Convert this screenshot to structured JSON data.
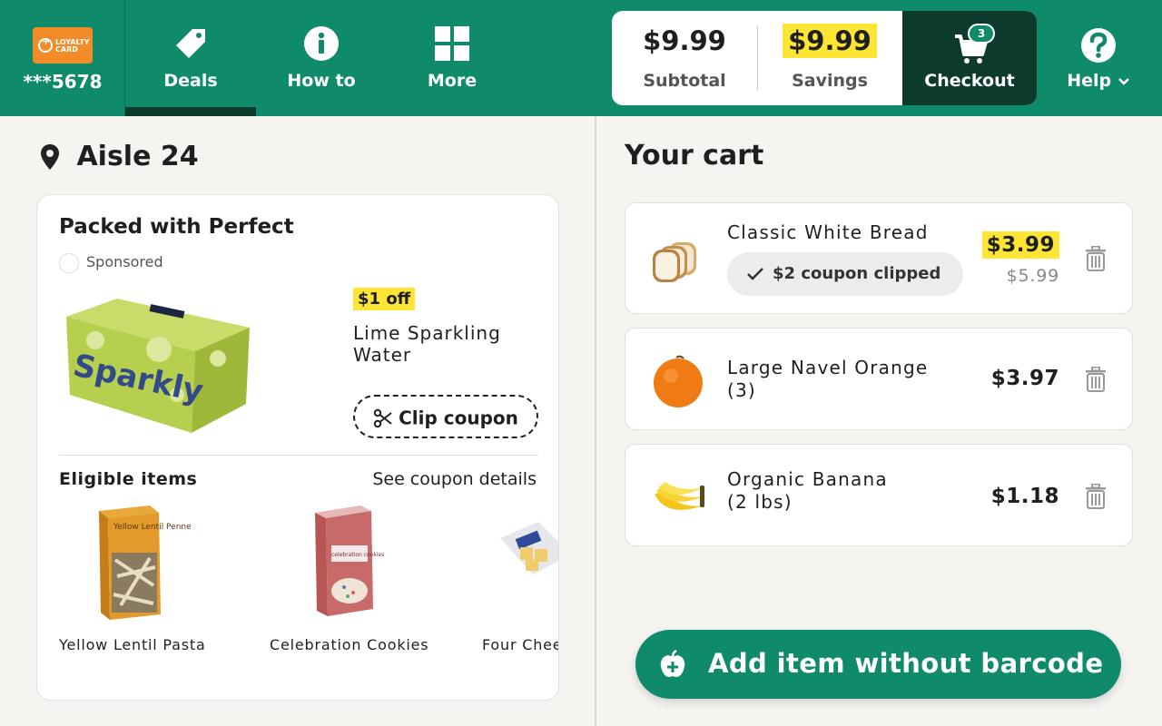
{
  "header": {
    "loyalty": {
      "card_label": "LOYALTY CARD",
      "number": "***5678"
    },
    "nav": [
      {
        "label": "Deals",
        "icon": "tag-icon",
        "active": true
      },
      {
        "label": "How to",
        "icon": "info-icon",
        "active": false
      },
      {
        "label": "More",
        "icon": "grid-icon",
        "active": false
      }
    ],
    "totals": {
      "subtotal_amount": "$9.99",
      "subtotal_label": "Subtotal",
      "savings_amount": "$9.99",
      "savings_label": "Savings"
    },
    "checkout": {
      "label": "Checkout",
      "count": "3"
    },
    "help": {
      "label": "Help"
    }
  },
  "left": {
    "location": "Aisle 24",
    "deal": {
      "title": "Packed with Perfect",
      "sponsored": "Sponsored",
      "product_box_text": "Sparkly",
      "badge": "$1 off",
      "product_name": "Lime Sparkling Water",
      "clip_label": "Clip coupon",
      "eligible_label": "Eligible items",
      "details_link": "See coupon details",
      "items": [
        {
          "name": "Yellow Lentil Pasta",
          "box_text": "Yellow Lentil Penne"
        },
        {
          "name": "Celebration Cookies",
          "box_text": "celebration cookies"
        },
        {
          "name": "Four Chee",
          "box_text": ""
        }
      ]
    }
  },
  "cart": {
    "title": "Your cart",
    "items": [
      {
        "name": "Classic White Bread",
        "price": "$3.99",
        "original_price": "$5.99",
        "coupon": "$2 coupon clipped",
        "icon": "bread-icon"
      },
      {
        "name": "Large Navel Orange",
        "qty": "(3)",
        "price": "$3.97",
        "icon": "orange-icon"
      },
      {
        "name": "Organic Banana",
        "qty": "(2 lbs)",
        "price": "$1.18",
        "icon": "banana-icon"
      }
    ],
    "add_button": "Add item without barcode"
  },
  "colors": {
    "brand_green": "#0f8a6b",
    "dark_green": "#0c3a2d",
    "highlight_yellow": "#ffe533",
    "loyalty_orange": "#f28c28"
  }
}
